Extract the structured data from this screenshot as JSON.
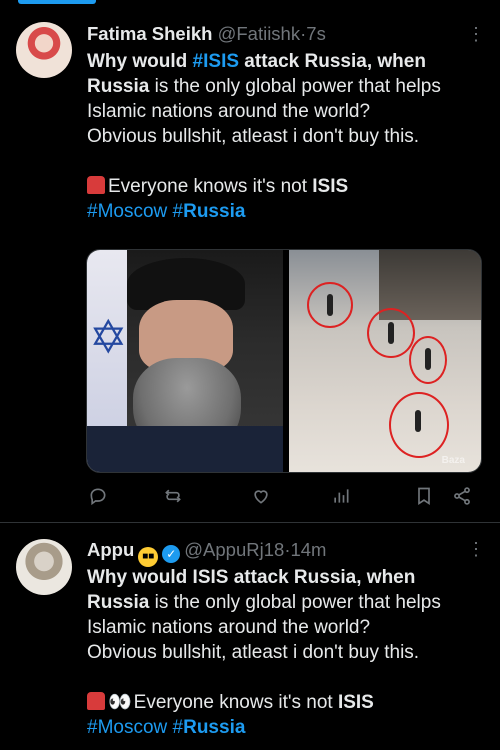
{
  "tweets": [
    {
      "name": "Fatima Sheikh",
      "handle": "@Fatiishk",
      "time": "7s",
      "line1": {
        "pre": "Why would ",
        "hashtag": "#ISIS",
        "post": " attack Russia, when"
      },
      "line2": {
        "bold": "Russia",
        "rest": " is the only global power that helps"
      },
      "line3": "Islamic nations around the world?",
      "line4": "Obvious bullshit, atleast i don't buy this.",
      "line5": {
        "pre": "Everyone knows it's not ",
        "bold": "ISIS"
      },
      "tags": {
        "tag1": "#Moscow",
        "tag2_hash": "#",
        "tag2_bold": "Russia"
      },
      "media": {
        "watermark": "Baza"
      }
    },
    {
      "name": "Appu",
      "handle": "@AppuRj18",
      "time": "14m",
      "line1": "Why would ISIS attack Russia, when",
      "line2": {
        "bold": "Russia",
        "rest": " is the only global power that helps"
      },
      "line3": "Islamic nations around the world?",
      "line4": "Obvious bullshit, atleast i don't buy this.",
      "line5": {
        "eyes": "👀",
        "pre": "Everyone knows it's not ",
        "bold": "ISIS"
      },
      "tags": {
        "tag1": "#Moscow",
        "tag2_hash": "#",
        "tag2_bold": "Russia"
      }
    }
  ],
  "separator": "·",
  "colors": {
    "accent": "#1d9bf0",
    "background": "#000000",
    "muted": "#71767b",
    "text": "#e7e9ea"
  },
  "icons": [
    "reply-icon",
    "retweet-icon",
    "like-icon",
    "views-icon",
    "bookmark-icon",
    "share-icon",
    "more-icon",
    "verified-icon",
    "siren-emoji-icon",
    "sunglasses-emoji-icon",
    "eyes-emoji-icon"
  ]
}
